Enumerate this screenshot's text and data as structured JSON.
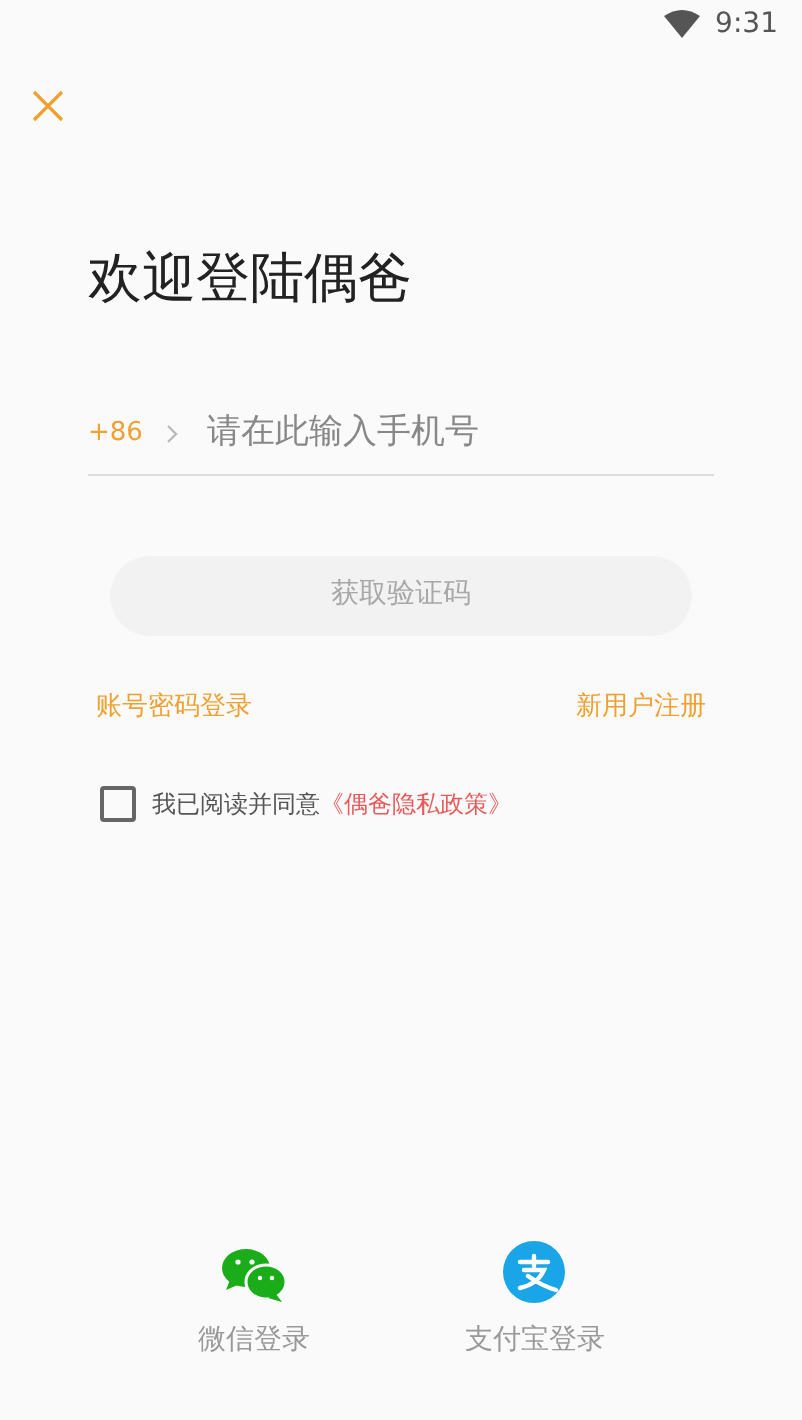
{
  "status_bar": {
    "time": "9:31"
  },
  "title": "欢迎登陆偶爸",
  "phone": {
    "country_code": "+86",
    "placeholder": "请在此输入手机号"
  },
  "get_code_button": {
    "label": "获取验证码",
    "disabled": true
  },
  "links": [
    "账号密码登录",
    "新用户注册"
  ],
  "agreement": {
    "checked": false,
    "text": "我已阅读并同意",
    "policy_link": "《偶爸隐私政策》"
  },
  "social_logins": [
    {
      "kind": "wechat",
      "label": "微信登录"
    },
    {
      "kind": "alipay",
      "label": "支付宝登录"
    }
  ]
}
